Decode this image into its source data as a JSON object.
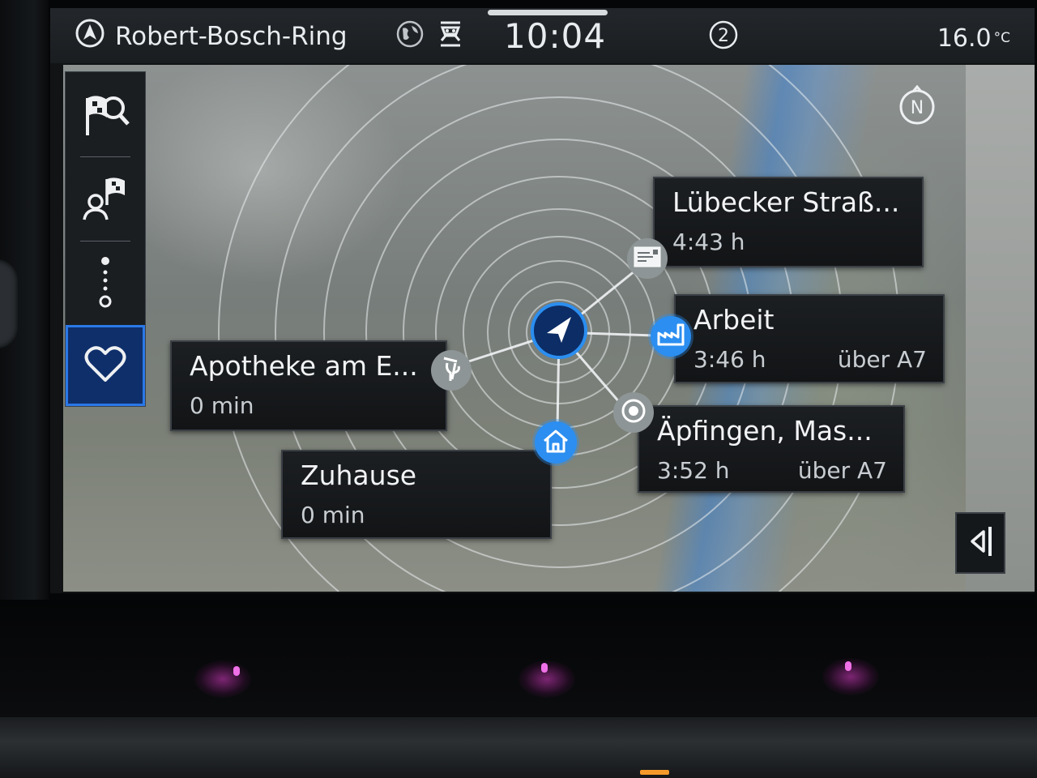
{
  "status_bar": {
    "street": "Robert-Bosch-Ring",
    "time": "10:04",
    "badge_count": "2",
    "temperature": "16.0",
    "temperature_unit": "°C",
    "icons": [
      "navigation-arrow-icon",
      "globe-icon",
      "traffic-icon",
      "badge-number-icon"
    ]
  },
  "sidebar": {
    "items": [
      {
        "name": "destination-search",
        "icon": "flag-search-icon"
      },
      {
        "name": "contacts-destination",
        "icon": "person-flag-icon"
      },
      {
        "name": "route-stops",
        "icon": "route-icon"
      },
      {
        "name": "favorites",
        "icon": "heart-icon",
        "selected": true
      }
    ]
  },
  "destinations": [
    {
      "title": "Lübecker Straß...",
      "time": "4:43 h",
      "via": "",
      "pin_icon": "message-icon",
      "pin_color": "#8e9596"
    },
    {
      "title": "Arbeit",
      "time": "3:46 h",
      "via": "über A7",
      "pin_icon": "factory-icon",
      "pin_color": "#2b8ef0"
    },
    {
      "title": "Äpfingen, Mas...",
      "time": "3:52 h",
      "via": "über A7",
      "pin_icon": "target-icon",
      "pin_color": "#8e9596"
    },
    {
      "title": "Apotheke am E...",
      "time": "0 min",
      "via": "",
      "pin_icon": "pharmacy-icon",
      "pin_color": "#8e9596"
    },
    {
      "title": "Zuhause",
      "time": "0 min",
      "via": "",
      "pin_icon": "home-icon",
      "pin_color": "#2b8ef0"
    }
  ],
  "map": {
    "compass_label": "N",
    "accent_color": "#2b8ef0",
    "sidebar_selected_color": "#0f2f6b"
  }
}
